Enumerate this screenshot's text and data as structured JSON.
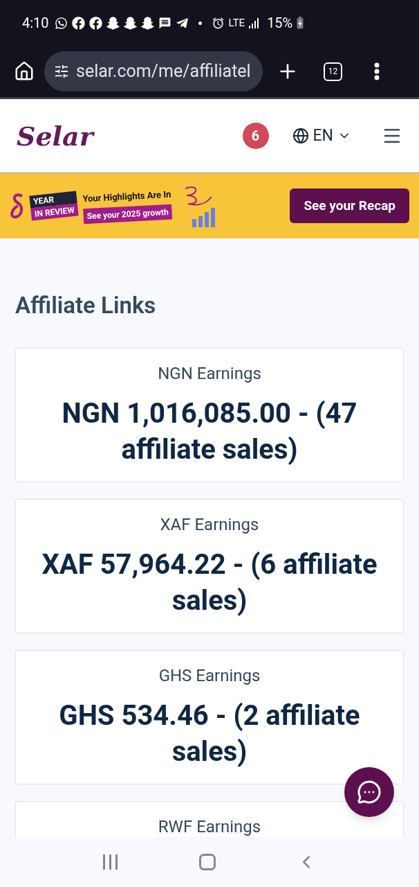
{
  "status_bar": {
    "time": "4:10",
    "network": "LTE",
    "battery": "15%"
  },
  "browser": {
    "url": "selar.com/me/affiliatel",
    "tab_count": "12"
  },
  "header": {
    "logo": "Selar",
    "notification_count": "6",
    "language": "EN"
  },
  "banner": {
    "tag_top": "YEAR",
    "tag_bottom": "IN REVIEW",
    "headline": "Your Highlights Are In",
    "subline": "See your 2025 growth",
    "button": "See your Recap"
  },
  "page": {
    "title": "Affiliate Links"
  },
  "cards": [
    {
      "label": "NGN Earnings",
      "value": "NGN 1,016,085.00 - (47 affiliate sales)"
    },
    {
      "label": "XAF Earnings",
      "value": "XAF 57,964.22 - (6 affiliate sales)"
    },
    {
      "label": "GHS Earnings",
      "value": "GHS 534.46 - (2 affiliate sales)"
    },
    {
      "label": "RWF Earnings"
    }
  ]
}
